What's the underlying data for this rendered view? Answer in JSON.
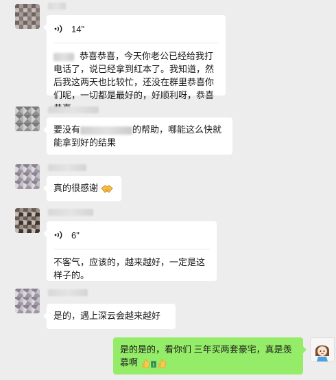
{
  "messages": [
    {
      "voice_duration": "14\"",
      "transcript_text": "恭喜恭喜，今天你老公已经给我打电话了，说已经拿到红本了。我知道，然后我这两天也比较忙，还没在群里恭喜你们呢，一切都是最好的，好顺利呀，恭喜恭喜。"
    },
    {
      "text_before": "要没有",
      "text_after": "的帮助，哪能这么快就能拿到好的结果"
    },
    {
      "text": "真的很感谢",
      "emoji": "handshake-emoji"
    },
    {
      "voice_duration": "6\"",
      "transcript_text": "不客气，应该的，越来越好，一定是这样子的。"
    },
    {
      "text": "是的，遇上深云会越来越好"
    },
    {
      "text": "是的是的，看你们 三年买两套豪宅，真是羡慕啊",
      "emojis": [
        "thumbs-up-emoji",
        "money-bag-emoji",
        "thumbs-up-emoji"
      ]
    }
  ],
  "colors": {
    "background": "#ededed",
    "incoming_bubble": "#ffffff",
    "outgoing_bubble": "#95ec69"
  }
}
